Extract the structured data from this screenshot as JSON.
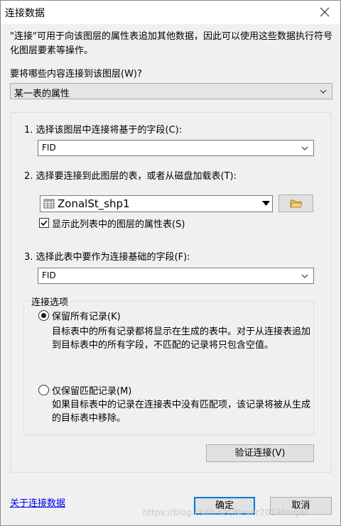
{
  "window": {
    "title": "连接数据"
  },
  "description": "\"连接\"可用于向该图层的属性表追加其他数据，因此可以使用这些数据执行符号化图层要素等操作。",
  "join_what_label": "要将哪些内容连接到该图层(W)?",
  "join_type": {
    "value": "某一表的属性"
  },
  "step1": {
    "label": "1. 选择该图层中连接将基于的字段(C):",
    "field_value": "FID"
  },
  "step2": {
    "label": "2. 选择要连接到此图层的表，或者从磁盘加载表(T):",
    "table_value": "ZonalSt_shp1",
    "checkbox_label": "显示此列表中的图层的属性表(S)",
    "checkbox_checked": true
  },
  "step3": {
    "label": "3. 选择此表中要作为连接基础的字段(F):",
    "field_value": "FID"
  },
  "join_options": {
    "legend": "连接选项",
    "keep_all": {
      "label": "保留所有记录(K)",
      "checked": true,
      "description": "目标表中的所有记录都将显示在生成的表中。对于从连接表追加到目标表中的所有字段，不匹配的记录将只包含空值。"
    },
    "keep_matching": {
      "label": "仅保留匹配记录(M)",
      "checked": false,
      "description": "如果目标表中的记录在连接表中没有匹配项，该记录将被从生成的目标表中移除。"
    }
  },
  "validate_button": "验证连接(V)",
  "about_link": "关于连接数据",
  "ok_button": "确定",
  "cancel_button": "取消",
  "watermark": "https://blog.csdn.net/Never2019Forget",
  "icons": {
    "close": "close-icon",
    "dropdown": "chevron-down-icon",
    "table": "table-icon",
    "folder": "open-folder-icon"
  },
  "colors": {
    "link": "#0000ee",
    "default_button_border": "#0078d7",
    "folder_icon": "#e8b84a"
  }
}
